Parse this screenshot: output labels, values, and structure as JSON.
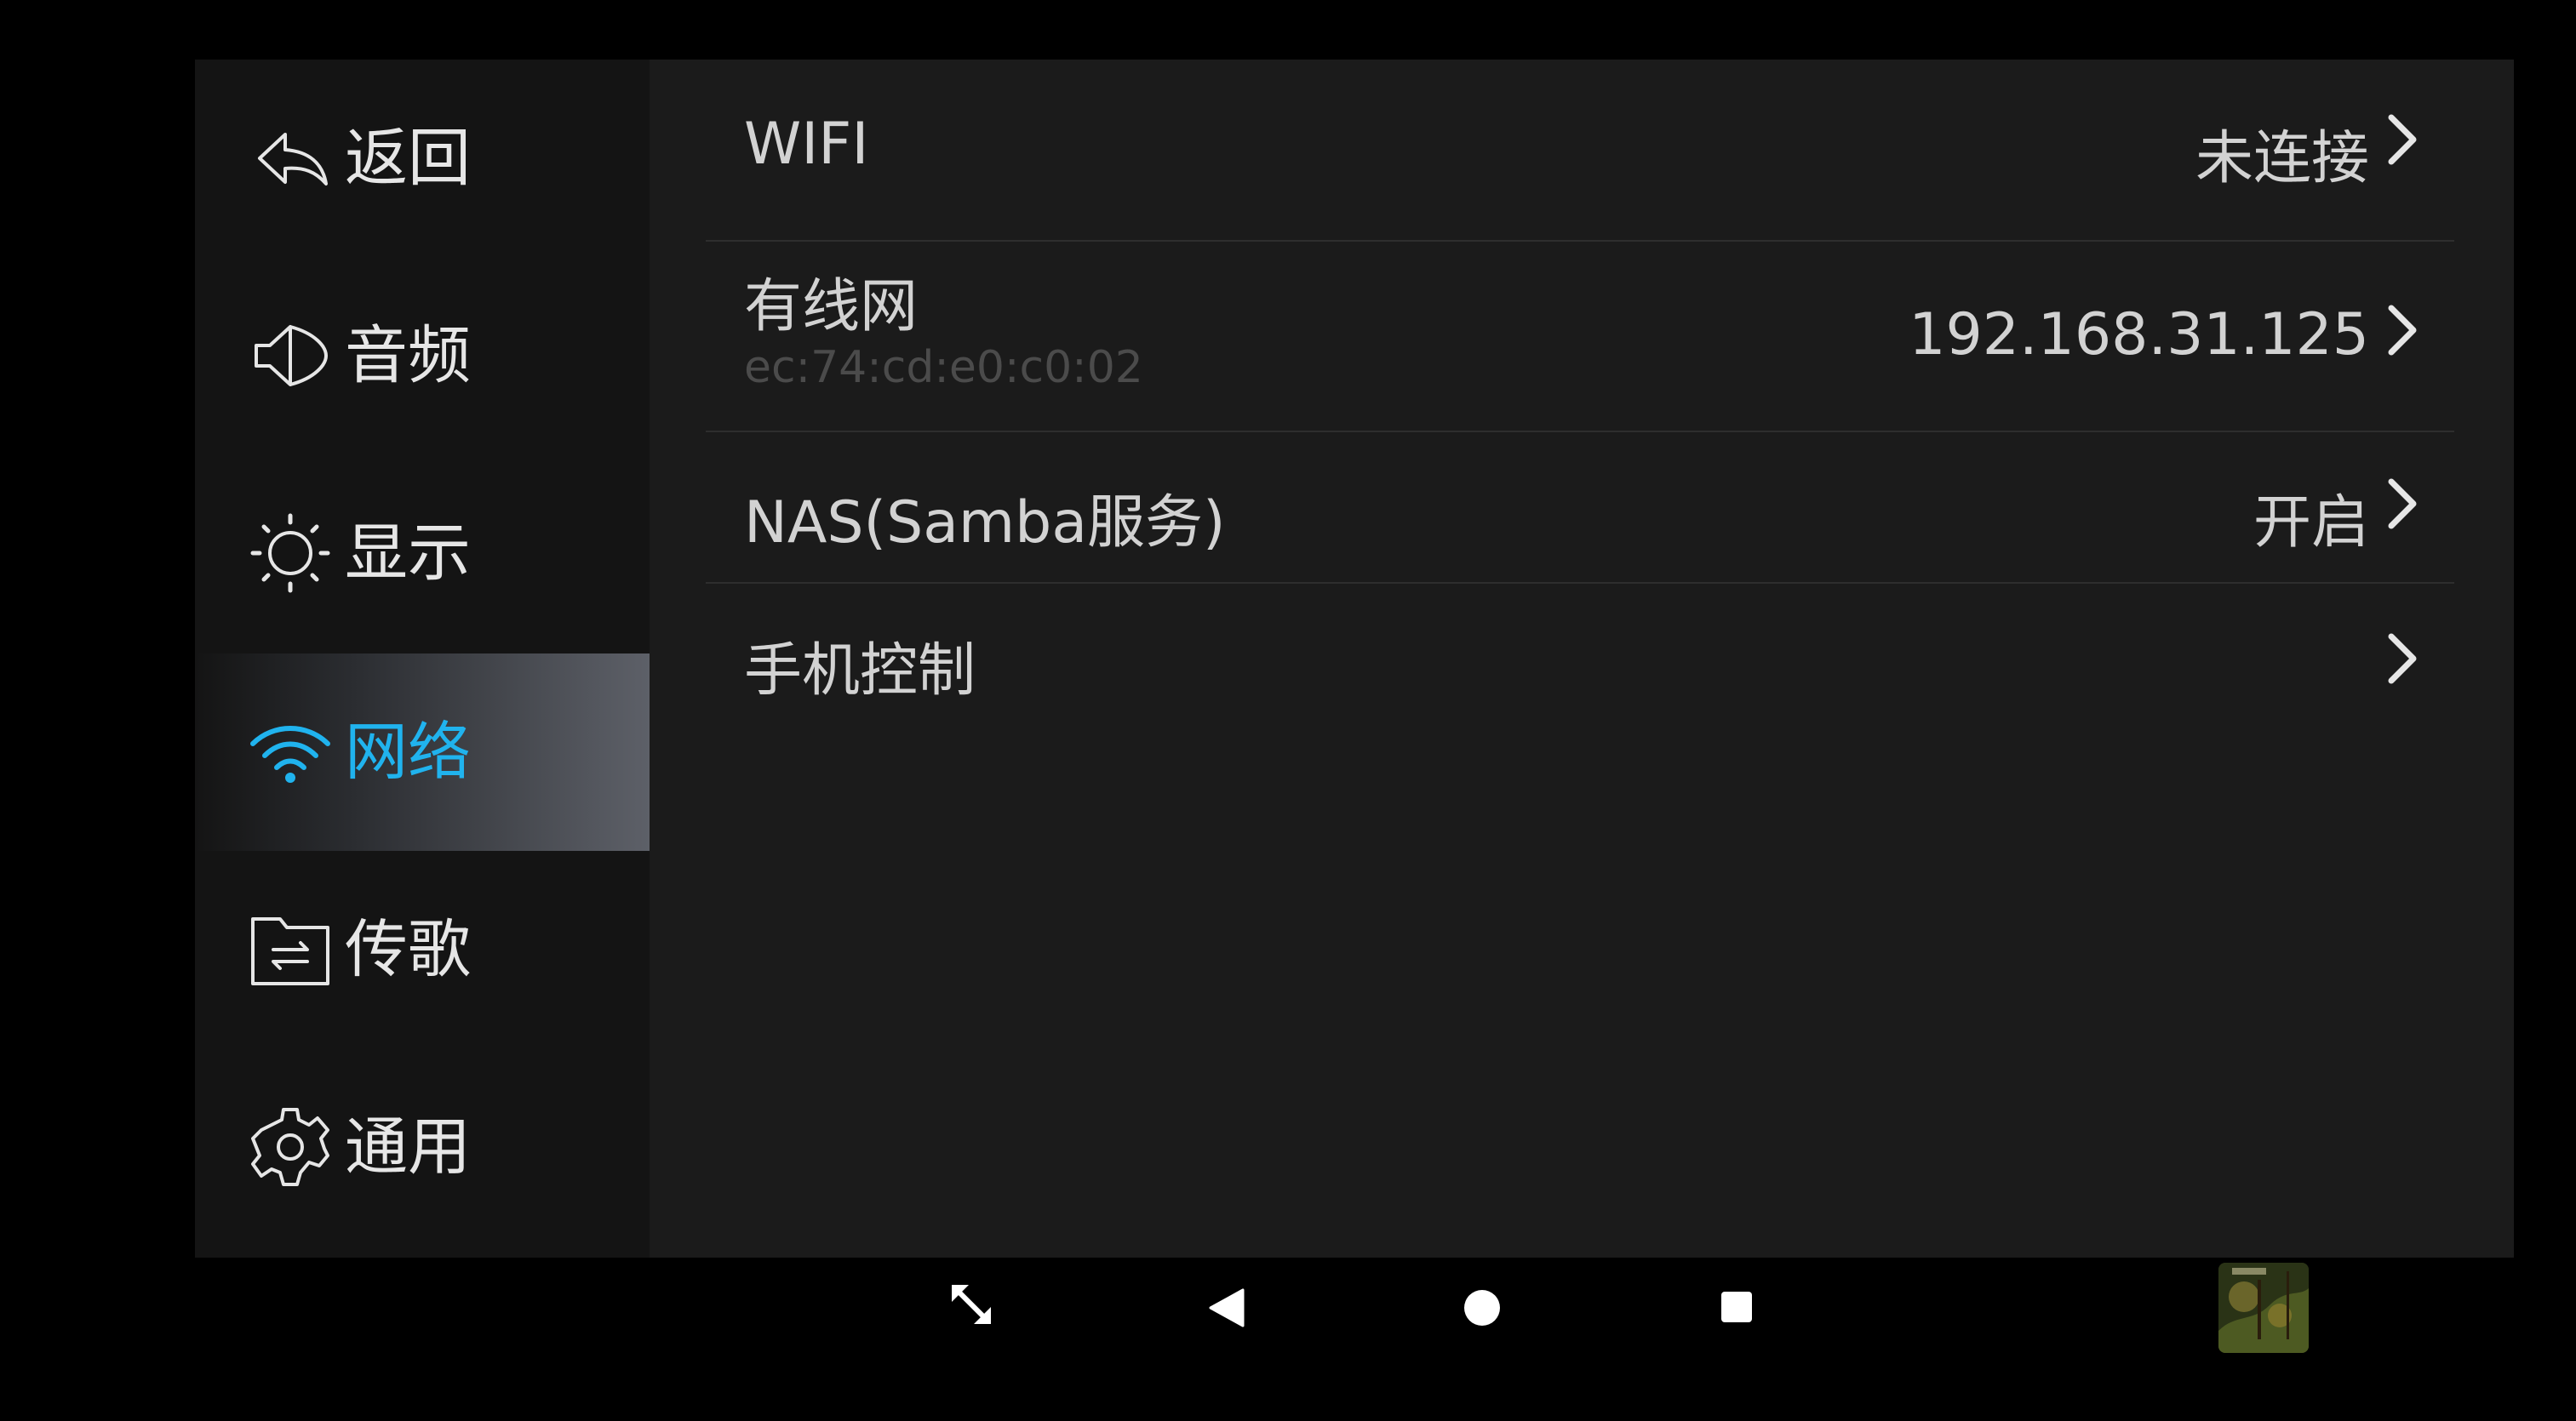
{
  "sidebar": {
    "items": [
      {
        "label": "返回",
        "icon": "back-arrow-icon"
      },
      {
        "label": "音频",
        "icon": "speaker-icon"
      },
      {
        "label": "显示",
        "icon": "brightness-icon"
      },
      {
        "label": "网络",
        "icon": "wifi-icon",
        "active": true
      },
      {
        "label": "传歌",
        "icon": "folder-transfer-icon"
      },
      {
        "label": "通用",
        "icon": "gear-icon"
      }
    ]
  },
  "network": {
    "wifi": {
      "label": "WIFI",
      "value": "未连接"
    },
    "wired": {
      "label": "有线网",
      "mac": "ec:74:cd:e0:c0:02",
      "value": "192.168.31.125"
    },
    "nas": {
      "label": "NAS(Samba服务)",
      "value": "开启"
    },
    "phone": {
      "label": "手机控制"
    }
  },
  "navbar": {
    "buttons": [
      "fullscreen-icon",
      "back-triangle-icon",
      "home-circle-icon",
      "recents-square-icon"
    ],
    "now_playing_thumbnail": "album-art"
  },
  "colors": {
    "accent": "#20b3ee",
    "sidebar_bg": "#141414",
    "content_bg": "#1b1b1b",
    "text": "#d2d2d2",
    "subtext": "#4b4b4b"
  }
}
